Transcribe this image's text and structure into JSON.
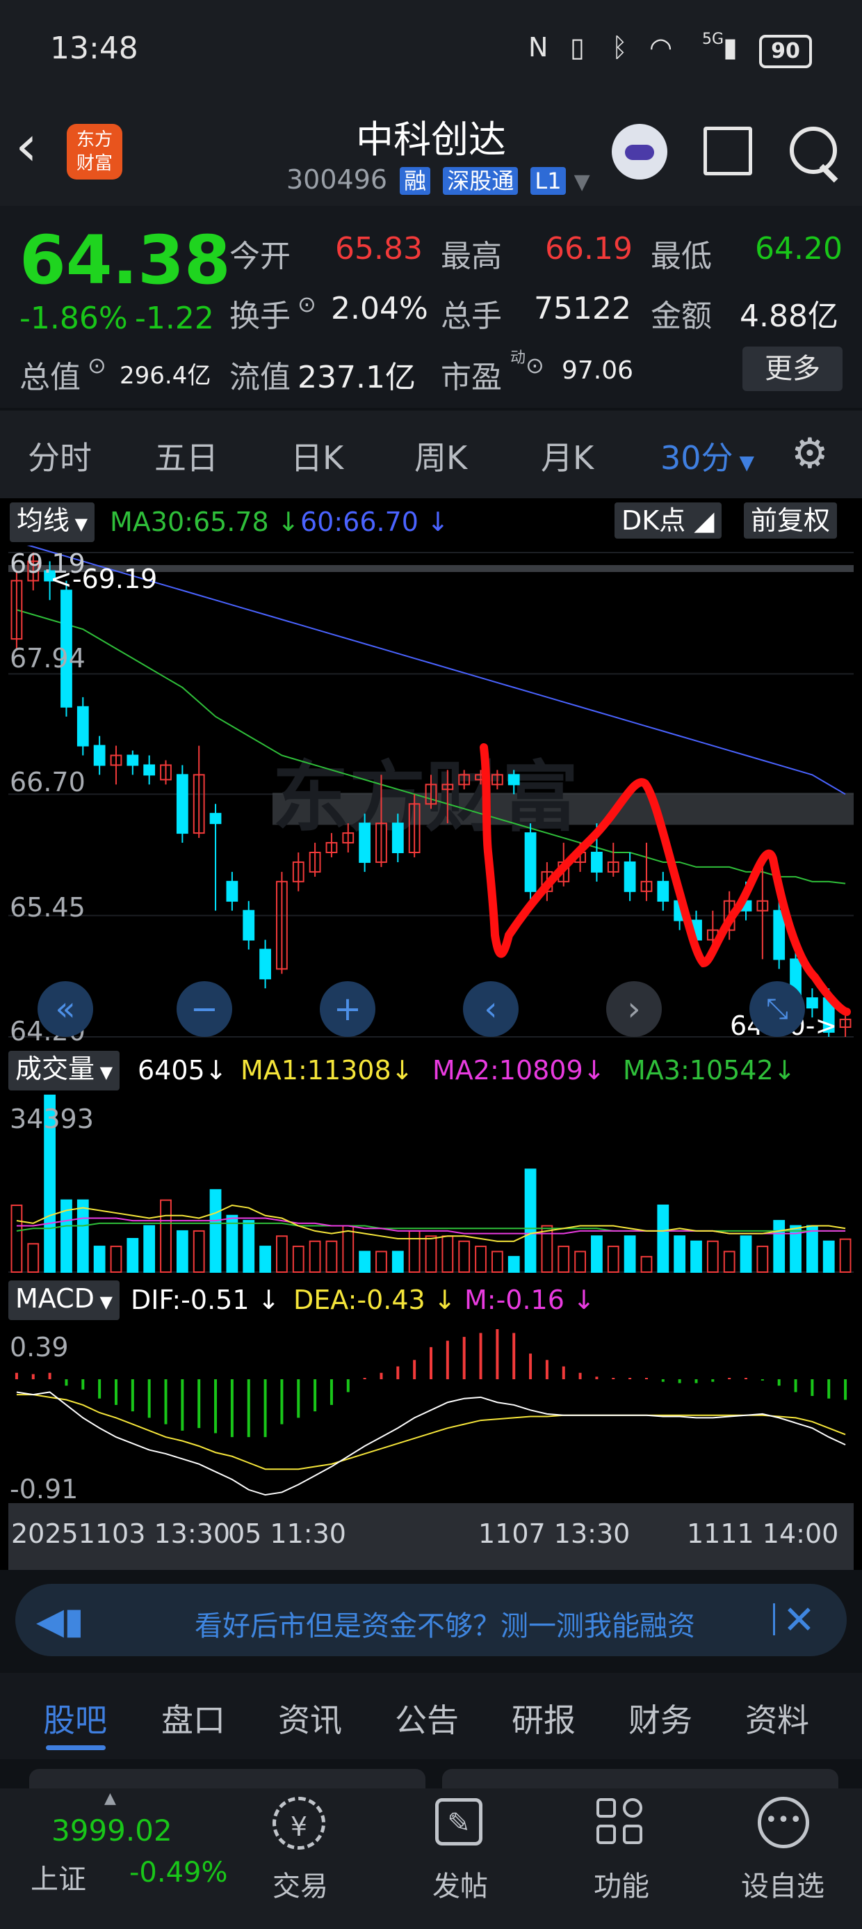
{
  "status_bar": {
    "time": "13:48",
    "battery": "90",
    "network": "5G"
  },
  "header": {
    "logo_line1": "东方",
    "logo_line2": "财富",
    "title": "中科创达",
    "code": "300496",
    "tags": [
      "融",
      "深股通",
      "L1"
    ]
  },
  "quote": {
    "price": "64.38",
    "change_pct": "-1.86%",
    "change": "-1.22",
    "open_label": "今开",
    "open": "65.83",
    "high_label": "最高",
    "high": "66.19",
    "low_label": "最低",
    "low": "64.20",
    "turnover_label": "换手",
    "turnover": "2.04%",
    "volume_label": "总手",
    "volume": "75122",
    "amount_label": "金额",
    "amount": "4.88亿",
    "mktcap_label": "总值",
    "mktcap": "296.4亿",
    "float_label": "流值",
    "float": "237.1亿",
    "pe_label": "市盈",
    "pe_sup": "动",
    "pe": "97.06",
    "more_label": "更多"
  },
  "period_tabs": [
    "分时",
    "五日",
    "日K",
    "周K",
    "月K",
    "30分"
  ],
  "active_period": "30分",
  "chart": {
    "ma_label": "均线",
    "ma30": "MA30:65.78",
    "ma60": "60:66.70",
    "dk_label": "DK点",
    "adjust_label": "前复权",
    "price_ticks": [
      "69.19",
      "67.94",
      "66.70",
      "65.45",
      "64.20"
    ],
    "max_marker": "<-69.19",
    "min_marker": "64.20->",
    "vol_label": "成交量",
    "vol_value": "6405",
    "vol_ma1": "MA1:11308",
    "vol_ma2": "MA2:10809",
    "vol_ma3": "MA3:10542",
    "vol_max_tick": "34393",
    "macd_label": "MACD",
    "dif": "DIF:-0.51",
    "dea": "DEA:-0.43",
    "m": "M:-0.16",
    "macd_ticks": [
      "0.39",
      "-0.91"
    ],
    "time_labels": [
      "20251103 13:30",
      "05 11:30",
      "1107 13:30",
      "1111 14:00"
    ]
  },
  "chart_data": {
    "type": "candlestick",
    "ylim": [
      64.2,
      69.19
    ],
    "candles": [
      {
        "o": 68.3,
        "c": 68.9,
        "h": 69.0,
        "l": 68.2
      },
      {
        "o": 68.9,
        "c": 69.1,
        "h": 69.19,
        "l": 68.8
      },
      {
        "o": 69.0,
        "c": 68.9,
        "h": 69.1,
        "l": 68.7
      },
      {
        "o": 68.8,
        "c": 67.6,
        "h": 68.9,
        "l": 67.5
      },
      {
        "o": 67.6,
        "c": 67.2,
        "h": 67.7,
        "l": 67.1
      },
      {
        "o": 67.2,
        "c": 67.0,
        "h": 67.3,
        "l": 66.9
      },
      {
        "o": 67.0,
        "c": 67.1,
        "h": 67.2,
        "l": 66.8
      },
      {
        "o": 67.1,
        "c": 67.0,
        "h": 67.15,
        "l": 66.9
      },
      {
        "o": 67.0,
        "c": 66.9,
        "h": 67.1,
        "l": 66.8
      },
      {
        "o": 66.85,
        "c": 67.0,
        "h": 67.05,
        "l": 66.8
      },
      {
        "o": 66.9,
        "c": 66.3,
        "h": 67.0,
        "l": 66.2
      },
      {
        "o": 66.3,
        "c": 66.9,
        "h": 67.2,
        "l": 66.25
      },
      {
        "o": 66.5,
        "c": 66.4,
        "h": 66.6,
        "l": 65.5
      },
      {
        "o": 65.8,
        "c": 65.6,
        "h": 65.9,
        "l": 65.5
      },
      {
        "o": 65.5,
        "c": 65.2,
        "h": 65.6,
        "l": 65.1
      },
      {
        "o": 65.1,
        "c": 64.8,
        "h": 65.2,
        "l": 64.7
      },
      {
        "o": 64.9,
        "c": 65.8,
        "h": 65.9,
        "l": 64.85
      },
      {
        "o": 65.8,
        "c": 66.0,
        "h": 66.1,
        "l": 65.7
      },
      {
        "o": 65.9,
        "c": 66.1,
        "h": 66.2,
        "l": 65.85
      },
      {
        "o": 66.1,
        "c": 66.2,
        "h": 66.3,
        "l": 66.05
      },
      {
        "o": 66.2,
        "c": 66.3,
        "h": 66.4,
        "l": 66.1
      },
      {
        "o": 66.4,
        "c": 66.0,
        "h": 66.5,
        "l": 65.9
      },
      {
        "o": 66.0,
        "c": 66.4,
        "h": 66.9,
        "l": 65.95
      },
      {
        "o": 66.4,
        "c": 66.1,
        "h": 66.5,
        "l": 66.0
      },
      {
        "o": 66.1,
        "c": 66.6,
        "h": 66.7,
        "l": 66.05
      },
      {
        "o": 66.6,
        "c": 66.8,
        "h": 66.9,
        "l": 66.55
      },
      {
        "o": 66.75,
        "c": 66.8,
        "h": 66.95,
        "l": 66.4
      },
      {
        "o": 66.8,
        "c": 66.9,
        "h": 66.95,
        "l": 66.75
      },
      {
        "o": 66.85,
        "c": 66.9,
        "h": 66.95,
        "l": 66.8
      },
      {
        "o": 66.8,
        "c": 66.9,
        "h": 66.95,
        "l": 66.75
      },
      {
        "o": 66.9,
        "c": 66.8,
        "h": 66.95,
        "l": 66.7
      },
      {
        "o": 66.3,
        "c": 65.7,
        "h": 66.4,
        "l": 65.5
      },
      {
        "o": 65.7,
        "c": 65.9,
        "h": 66.0,
        "l": 65.6
      },
      {
        "o": 65.8,
        "c": 66.0,
        "h": 66.2,
        "l": 65.75
      },
      {
        "o": 66.0,
        "c": 66.1,
        "h": 66.2,
        "l": 65.9
      },
      {
        "o": 66.1,
        "c": 65.9,
        "h": 66.4,
        "l": 65.8
      },
      {
        "o": 65.9,
        "c": 66.0,
        "h": 66.2,
        "l": 65.85
      },
      {
        "o": 66.0,
        "c": 65.7,
        "h": 66.1,
        "l": 65.6
      },
      {
        "o": 65.7,
        "c": 65.8,
        "h": 66.2,
        "l": 65.6
      },
      {
        "o": 65.8,
        "c": 65.6,
        "h": 65.9,
        "l": 65.5
      },
      {
        "o": 65.6,
        "c": 65.4,
        "h": 65.7,
        "l": 65.3
      },
      {
        "o": 65.4,
        "c": 65.2,
        "h": 65.5,
        "l": 65.1
      },
      {
        "o": 65.2,
        "c": 65.3,
        "h": 65.5,
        "l": 65.1
      },
      {
        "o": 65.3,
        "c": 65.6,
        "h": 65.7,
        "l": 65.2
      },
      {
        "o": 65.6,
        "c": 65.5,
        "h": 65.8,
        "l": 65.4
      },
      {
        "o": 65.5,
        "c": 65.6,
        "h": 66.0,
        "l": 65.0
      },
      {
        "o": 65.5,
        "c": 65.0,
        "h": 65.6,
        "l": 64.9
      },
      {
        "o": 65.0,
        "c": 64.6,
        "h": 65.1,
        "l": 64.5
      },
      {
        "o": 64.6,
        "c": 64.5,
        "h": 64.7,
        "l": 64.4
      },
      {
        "o": 64.6,
        "c": 64.25,
        "h": 64.7,
        "l": 64.2
      },
      {
        "o": 64.3,
        "c": 64.38,
        "h": 64.45,
        "l": 64.2
      }
    ],
    "ma30": [
      68.6,
      68.55,
      68.5,
      68.45,
      68.4,
      68.3,
      68.2,
      68.1,
      68.0,
      67.9,
      67.8,
      67.65,
      67.5,
      67.4,
      67.3,
      67.2,
      67.1,
      67.05,
      67.0,
      66.95,
      66.9,
      66.85,
      66.8,
      66.75,
      66.7,
      66.65,
      66.6,
      66.55,
      66.5,
      66.45,
      66.4,
      66.35,
      66.3,
      66.25,
      66.2,
      66.15,
      66.1,
      66.1,
      66.05,
      66.0,
      66.0,
      65.95,
      65.95,
      65.95,
      65.9,
      65.9,
      65.85,
      65.85,
      65.8,
      65.8,
      65.78
    ],
    "ma60": [
      69.3,
      69.25,
      69.2,
      69.15,
      69.1,
      69.05,
      69.0,
      68.95,
      68.9,
      68.85,
      68.8,
      68.75,
      68.7,
      68.65,
      68.6,
      68.55,
      68.5,
      68.45,
      68.4,
      68.35,
      68.3,
      68.25,
      68.2,
      68.15,
      68.1,
      68.05,
      68.0,
      67.95,
      67.9,
      67.85,
      67.8,
      67.75,
      67.7,
      67.65,
      67.6,
      67.55,
      67.5,
      67.45,
      67.4,
      67.35,
      67.3,
      67.25,
      67.2,
      67.15,
      67.1,
      67.05,
      67.0,
      66.95,
      66.9,
      66.8,
      66.7
    ],
    "volume": [
      13000,
      5500,
      34393,
      14000,
      14000,
      5000,
      5000,
      6500,
      9000,
      14000,
      8000,
      8000,
      16000,
      11000,
      10000,
      5000,
      7000,
      5000,
      6000,
      6000,
      9000,
      4000,
      4000,
      4000,
      8000,
      7000,
      7000,
      6000,
      5000,
      4000,
      3000,
      20000,
      9000,
      5000,
      4000,
      7000,
      5000,
      7000,
      3000,
      13000,
      7000,
      6000,
      6000,
      4000,
      7000,
      5000,
      10000,
      9000,
      9000,
      6000,
      6405
    ],
    "vol_ma1": [
      10000,
      9500,
      11000,
      12000,
      12500,
      12000,
      11500,
      11000,
      10500,
      11000,
      11000,
      10500,
      11500,
      13000,
      12500,
      11000,
      10500,
      9000,
      8000,
      7500,
      8000,
      7500,
      7000,
      6500,
      6500,
      6500,
      7000,
      7000,
      6500,
      6000,
      6000,
      7500,
      8000,
      8500,
      9000,
      9000,
      9000,
      8500,
      8000,
      8000,
      8500,
      8000,
      8000,
      7500,
      7500,
      7500,
      8000,
      8500,
      9000,
      9000,
      8500
    ],
    "vol_ma2": [
      9000,
      9000,
      9500,
      10000,
      10500,
      10500,
      10500,
      10000,
      10000,
      10000,
      10000,
      10000,
      10000,
      10500,
      10500,
      10500,
      10000,
      9500,
      9500,
      9000,
      9000,
      8500,
      8500,
      8000,
      8000,
      8000,
      8000,
      7500,
      7500,
      7500,
      7500,
      7500,
      7500,
      7500,
      8000,
      8000,
      8000,
      8000,
      8000,
      8000,
      8000,
      8000,
      8000,
      7500,
      7500,
      7500,
      7500,
      7500,
      8000,
      8000,
      8000
    ],
    "vol_ma3": [
      8000,
      8500,
      8500,
      9000,
      9000,
      9500,
      9500,
      9500,
      9500,
      9500,
      9500,
      9500,
      9500,
      9500,
      9500,
      9500,
      9500,
      9000,
      9000,
      9000,
      9000,
      9000,
      8500,
      8500,
      8500,
      8500,
      8500,
      8500,
      8500,
      8500,
      8500,
      8500,
      8500,
      8500,
      8500,
      8500,
      8000,
      8000,
      8000,
      8000,
      8000,
      8000,
      8000,
      8000,
      8000,
      8000,
      8000,
      8000,
      8000,
      8000,
      8000
    ],
    "macd": [
      0.05,
      0.04,
      0.05,
      -0.05,
      -0.08,
      -0.15,
      -0.2,
      -0.25,
      -0.3,
      -0.35,
      -0.4,
      -0.38,
      -0.42,
      -0.45,
      -0.45,
      -0.45,
      -0.35,
      -0.3,
      -0.25,
      -0.2,
      -0.1,
      0.0,
      0.05,
      0.1,
      0.15,
      0.25,
      0.3,
      0.33,
      0.36,
      0.39,
      0.36,
      0.2,
      0.15,
      0.1,
      0.05,
      0.02,
      0.0,
      0.0,
      0.0,
      -0.02,
      -0.03,
      -0.03,
      -0.02,
      0.0,
      0.0,
      -0.01,
      -0.05,
      -0.1,
      -0.13,
      -0.15,
      -0.16
    ],
    "dif": [
      -0.1,
      -0.12,
      -0.1,
      -0.2,
      -0.3,
      -0.38,
      -0.45,
      -0.5,
      -0.55,
      -0.58,
      -0.62,
      -0.66,
      -0.72,
      -0.78,
      -0.86,
      -0.9,
      -0.88,
      -0.82,
      -0.75,
      -0.68,
      -0.6,
      -0.52,
      -0.45,
      -0.38,
      -0.3,
      -0.24,
      -0.18,
      -0.15,
      -0.14,
      -0.18,
      -0.2,
      -0.24,
      -0.27,
      -0.28,
      -0.28,
      -0.28,
      -0.28,
      -0.28,
      -0.28,
      -0.29,
      -0.29,
      -0.3,
      -0.3,
      -0.29,
      -0.28,
      -0.27,
      -0.3,
      -0.34,
      -0.38,
      -0.45,
      -0.51
    ],
    "dea": [
      -0.12,
      -0.12,
      -0.14,
      -0.16,
      -0.2,
      -0.26,
      -0.3,
      -0.35,
      -0.4,
      -0.45,
      -0.48,
      -0.52,
      -0.57,
      -0.6,
      -0.65,
      -0.7,
      -0.7,
      -0.7,
      -0.68,
      -0.66,
      -0.62,
      -0.58,
      -0.54,
      -0.5,
      -0.46,
      -0.42,
      -0.38,
      -0.35,
      -0.32,
      -0.31,
      -0.3,
      -0.29,
      -0.29,
      -0.28,
      -0.28,
      -0.28,
      -0.28,
      -0.28,
      -0.28,
      -0.28,
      -0.28,
      -0.28,
      -0.28,
      -0.28,
      -0.28,
      -0.28,
      -0.29,
      -0.3,
      -0.33,
      -0.38,
      -0.43
    ],
    "macd_ylim": [
      -0.91,
      0.39
    ]
  },
  "banner": {
    "text": "看好后市但是资金不够？测一测我能融资"
  },
  "bottom_tabs": [
    "股吧",
    "盘口",
    "资讯",
    "公告",
    "研报",
    "财务",
    "资料"
  ],
  "footer": {
    "index_value": "3999.02",
    "index_name": "上证",
    "index_change": "-0.49%",
    "items": [
      "交易",
      "发帖",
      "功能",
      "自选"
    ],
    "prefix_self": "设"
  },
  "colors": {
    "up": "#f23a3a",
    "down": "#19c619",
    "down_candle": "#00e5ff",
    "accent": "#3f7fe0"
  }
}
